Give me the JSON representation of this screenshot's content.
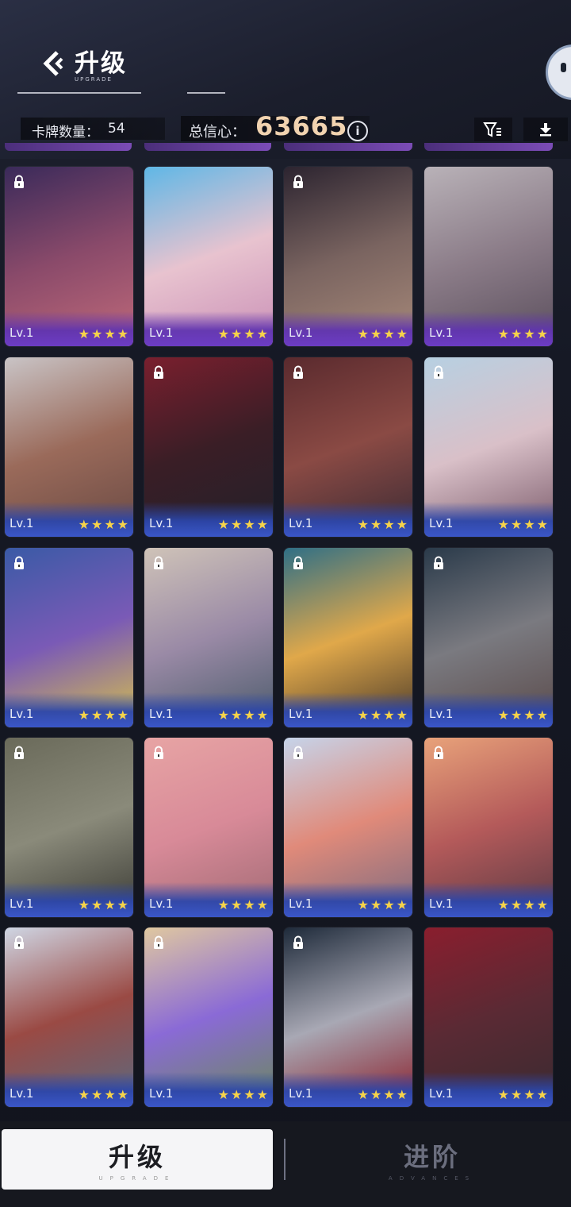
{
  "header": {
    "title": "升级",
    "title_sub": "UPGRADE",
    "card_count_label": "卡牌数量：",
    "card_count_value": "54",
    "trust_label": "总信心：",
    "trust_value": "63665",
    "info_glyph": "i"
  },
  "cards": [
    {
      "level": "Lv.1",
      "stars": 4,
      "locked": true,
      "theme": "purple",
      "art": [
        "#3a2a5a",
        "#8a4a6a",
        "#c06a7a"
      ]
    },
    {
      "level": "Lv.1",
      "stars": 4,
      "locked": false,
      "theme": "purple",
      "art": [
        "#5fb7e6",
        "#e8c3cf",
        "#c98fb6"
      ]
    },
    {
      "level": "Lv.1",
      "stars": 4,
      "locked": true,
      "theme": "purple",
      "art": [
        "#2c2430",
        "#7a6460",
        "#a88a7a"
      ]
    },
    {
      "level": "Lv.1",
      "stars": 4,
      "locked": false,
      "theme": "purple",
      "art": [
        "#b9b2b8",
        "#8b7c88",
        "#5a4e5c"
      ]
    },
    {
      "level": "Lv.1",
      "stars": 4,
      "locked": false,
      "theme": "blue",
      "art": [
        "#c9c4c6",
        "#9a6a5a",
        "#6a4a44"
      ]
    },
    {
      "level": "Lv.1",
      "stars": 4,
      "locked": true,
      "theme": "blue",
      "art": [
        "#7a1f2e",
        "#3a1e26",
        "#23202a"
      ]
    },
    {
      "level": "Lv.1",
      "stars": 4,
      "locked": true,
      "theme": "blue",
      "art": [
        "#5a2a2e",
        "#8a4a44",
        "#3a2a34"
      ]
    },
    {
      "level": "Lv.1",
      "stars": 4,
      "locked": true,
      "theme": "blue",
      "art": [
        "#b7d0e2",
        "#d9c0c8",
        "#7a5a6a"
      ]
    },
    {
      "level": "Lv.1",
      "stars": 4,
      "locked": true,
      "theme": "blue",
      "art": [
        "#3a5aa6",
        "#7a5ab6",
        "#d8c24a"
      ]
    },
    {
      "level": "Lv.1",
      "stars": 4,
      "locked": true,
      "theme": "blue",
      "art": [
        "#cfc3b8",
        "#9a8aa6",
        "#4a5a6a"
      ]
    },
    {
      "level": "Lv.1",
      "stars": 4,
      "locked": true,
      "theme": "blue",
      "art": [
        "#2f6f86",
        "#e0a84a",
        "#4a3a2a"
      ]
    },
    {
      "level": "Lv.1",
      "stars": 4,
      "locked": true,
      "theme": "blue",
      "art": [
        "#2a3a4a",
        "#7a7a80",
        "#5a4a4a"
      ]
    },
    {
      "level": "Lv.1",
      "stars": 4,
      "locked": true,
      "theme": "blue",
      "art": [
        "#6a6a5a",
        "#8a8a7a",
        "#3a3a34"
      ]
    },
    {
      "level": "Lv.1",
      "stars": 4,
      "locked": true,
      "theme": "blue",
      "art": [
        "#e7a4a4",
        "#d88a98",
        "#a06a74"
      ]
    },
    {
      "level": "Lv.1",
      "stars": 4,
      "locked": true,
      "theme": "blue",
      "art": [
        "#c6d4ea",
        "#e08a7a",
        "#7a6a80"
      ]
    },
    {
      "level": "Lv.1",
      "stars": 4,
      "locked": true,
      "theme": "blue",
      "art": [
        "#e8a27a",
        "#b45a5a",
        "#5a3a44"
      ]
    },
    {
      "level": "Lv.1",
      "stars": 4,
      "locked": true,
      "theme": "blue",
      "art": [
        "#cfd6e4",
        "#9a4a44",
        "#5a6a80"
      ]
    },
    {
      "level": "Lv.1",
      "stars": 4,
      "locked": true,
      "theme": "blue",
      "art": [
        "#e0c8a0",
        "#8a6ad6",
        "#6a8a5a"
      ]
    },
    {
      "level": "Lv.1",
      "stars": 4,
      "locked": true,
      "theme": "blue",
      "art": [
        "#1e2a3a",
        "#a8a8b4",
        "#8a1e2a"
      ]
    },
    {
      "level": "Lv.1",
      "stars": 4,
      "locked": false,
      "theme": "blue",
      "art": [
        "#8a1e2e",
        "#5a2a34",
        "#3a2a30"
      ]
    }
  ],
  "tabs": {
    "upgrade_label": "升级",
    "upgrade_sub": "UPGRADE",
    "advance_label": "进阶",
    "advance_sub": "ADVANCES"
  },
  "colors": {
    "star": "#f6d34a",
    "trust_value": "#f1d3b0",
    "card_purple": "#6c3cc4",
    "card_blue": "#3a56c8"
  },
  "icons": {
    "back": "back-arrow-icon",
    "filter": "filter-icon",
    "download": "download-icon",
    "lock": "lock-icon",
    "info": "info-icon"
  }
}
